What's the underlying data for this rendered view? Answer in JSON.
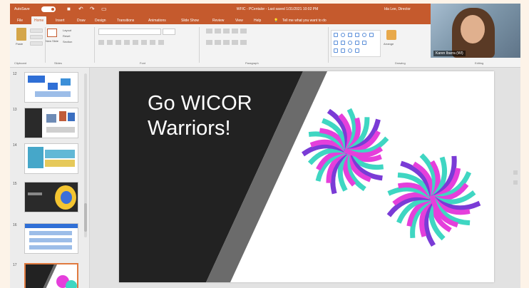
{
  "title_bar": {
    "autosave_label": "AutoSave",
    "autosave_state": "On",
    "quick_access": [
      "save-icon",
      "undo-icon",
      "redo-icon",
      "start-slideshow-icon"
    ],
    "doc_title": "WFIC - PCentalor - Last saved 1/31/2021 10:02 PM",
    "user_name": "Ida Lee, Director"
  },
  "ribbon_tabs": [
    "File",
    "Home",
    "Insert",
    "Draw",
    "Design",
    "Transitions",
    "Animations",
    "Slide Show",
    "Review",
    "View",
    "Help"
  ],
  "active_tab": "Home",
  "tell_me_placeholder": "Tell me what you want to do",
  "ribbon_groups": [
    "Clipboard",
    "Slides",
    "Font",
    "Paragraph",
    "Drawing",
    "Editing"
  ],
  "ribbon_buttons": {
    "paste": "Paste",
    "new_slide": "New Slide",
    "layout": "Layout",
    "reset": "Reset",
    "section": "Section",
    "arrange": "Arrange"
  },
  "webcam": {
    "participant_name": "Karen Ibarra (WI)",
    "colors": {
      "background": "#7f98ab",
      "skin": "#e0b08e",
      "hair": "#5a3a25"
    }
  },
  "thumbnails": [
    {
      "number": "12"
    },
    {
      "number": "13"
    },
    {
      "number": "14"
    },
    {
      "number": "15"
    },
    {
      "number": "16"
    },
    {
      "number": "17",
      "selected": true
    }
  ],
  "slide": {
    "title_line1": "Go WICOR",
    "title_line2": "Warriors!",
    "colors": {
      "dark_panel": "#222222",
      "stripe": "#6b6b6b",
      "pompom_magenta": "#e53fdb",
      "pompom_teal": "#3fd6c2",
      "pompom_purple": "#7a3bd6"
    }
  },
  "accent_color": "#c55a2d"
}
